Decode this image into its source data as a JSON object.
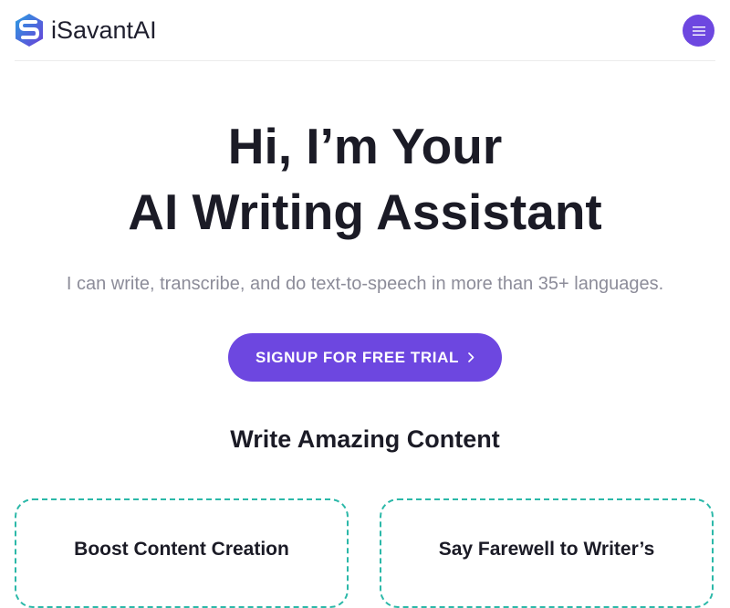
{
  "header": {
    "brand": "iSavantAI",
    "logo_icon": "isavant-hexagon-s-logo",
    "menu_icon": "hamburger-menu-icon"
  },
  "hero": {
    "title_line1": "Hi, I’m Your",
    "title_line2": "AI Writing Assistant",
    "subtitle": "I can write, transcribe, and do text-to-speech in more than 35+ languages.",
    "cta_label": "SIGNUP FOR FREE TRIAL",
    "cta_icon": "chevron-right-icon"
  },
  "features": {
    "section_title": "Write Amazing Content",
    "cards": [
      {
        "title": "Boost Content Creation"
      },
      {
        "title": "Say Farewell to Writer’s"
      }
    ]
  },
  "colors": {
    "accent": "#6d47e0",
    "card_border": "#2bb8a8",
    "logo_blue": "#2a7de1",
    "logo_purple": "#6a3fd8",
    "heading": "#1b1b26",
    "muted": "#8c8c99"
  }
}
